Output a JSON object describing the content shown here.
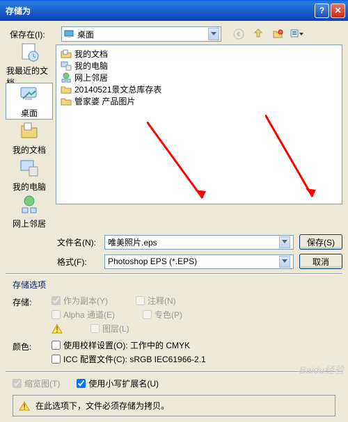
{
  "title": "存储为",
  "save_in_label": "保存在(I):",
  "save_in_value": "桌面",
  "sidebar": [
    {
      "label": "我最近的文档"
    },
    {
      "label": "桌面"
    },
    {
      "label": "我的文档"
    },
    {
      "label": "我的电脑"
    },
    {
      "label": "网上邻居"
    }
  ],
  "files": [
    {
      "label": "我的文档",
      "type": "folder-special"
    },
    {
      "label": "我的电脑",
      "type": "computer"
    },
    {
      "label": "网上邻居",
      "type": "network"
    },
    {
      "label": "20140521景文总库存表",
      "type": "folder"
    },
    {
      "label": "管家婆 产品图片",
      "type": "folder"
    }
  ],
  "filename_label": "文件名(N):",
  "filename_value": "唯美照片.eps",
  "format_label": "格式(F):",
  "format_value": "Photoshop EPS (*.EPS)",
  "save_button": "保存(S)",
  "cancel_button": "取消",
  "options_title": "存储选项",
  "storage_label": "存储:",
  "opts": {
    "as_copy": "作为副本(Y)",
    "annotations": "注释(N)",
    "alpha": "Alpha 通道(E)",
    "spot": "专色(P)",
    "layers": "图层(L)"
  },
  "color_label": "颜色:",
  "color_proof": "使用校样设置(O): 工作中的 CMYK",
  "color_icc": "ICC 配置文件(C): sRGB IEC61966-2.1",
  "thumbnail": "缩览图(T)",
  "lowercase_ext": "使用小写扩展名(U)",
  "warning_text": "在此选项下，文件必须存储为拷贝。",
  "watermark": "Baidu经验"
}
